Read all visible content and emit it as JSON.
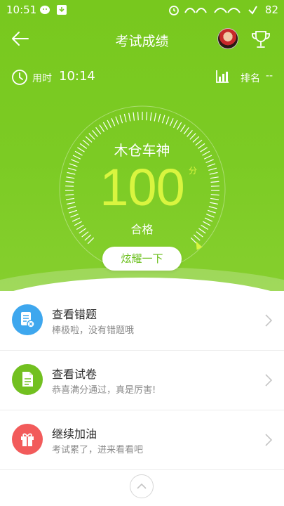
{
  "status_bar": {
    "time": "10:51",
    "battery": "82"
  },
  "header": {
    "title": "考试成绩"
  },
  "stats": {
    "time_label": "用时",
    "time_value": "10:14",
    "rank_label": "排名",
    "rank_value": "--"
  },
  "result": {
    "name": "木仓车神",
    "score": "100",
    "unit": "分",
    "status": "合格",
    "score_fraction": 1.0,
    "share_label": "炫耀一下"
  },
  "items": [
    {
      "title": "查看错题",
      "subtitle": "棒极啦，没有错题哦",
      "icon": "wrong-questions-icon",
      "color": "#3ea7ee"
    },
    {
      "title": "查看试卷",
      "subtitle": "恭喜满分通过，真是厉害!",
      "icon": "exam-paper-icon",
      "color": "#72c020"
    },
    {
      "title": "继续加油",
      "subtitle": "考试累了，进来看看吧",
      "icon": "gift-icon",
      "color": "#f25b5b"
    }
  ],
  "colors": {
    "accent_green": "#78c81e",
    "score_yellow": "#d9f53f"
  }
}
